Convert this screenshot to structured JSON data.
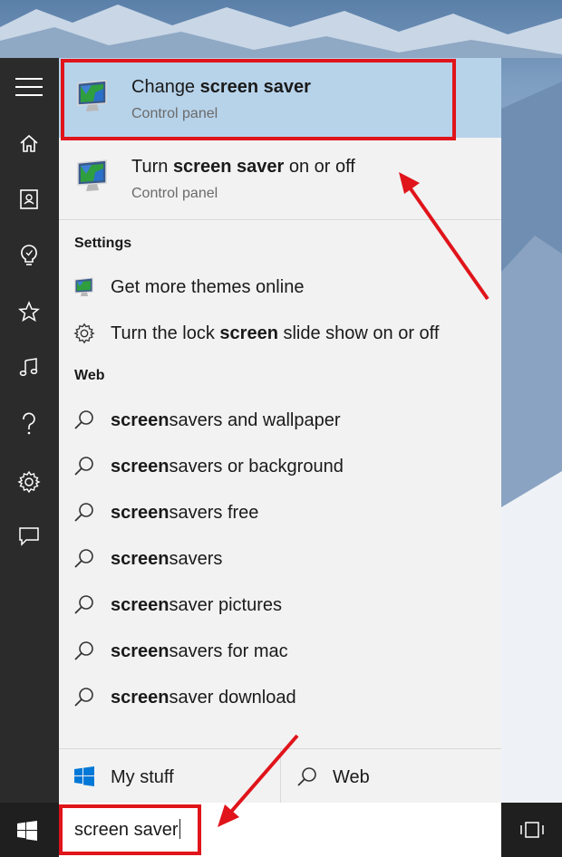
{
  "colors": {
    "accent_selected": "#b7d3ea",
    "annotation_red": "#e0141b",
    "sidebar": "#2b2b2b",
    "panel": "#f2f2f2"
  },
  "sidebar": {
    "items": [
      {
        "name": "hamburger-menu-icon"
      },
      {
        "name": "home-icon"
      },
      {
        "name": "notebook-icon"
      },
      {
        "name": "reminders-icon"
      },
      {
        "name": "favorites-icon"
      },
      {
        "name": "music-icon"
      },
      {
        "name": "help-icon"
      },
      {
        "name": "settings-gear-icon"
      },
      {
        "name": "feedback-icon"
      }
    ]
  },
  "best_match": [
    {
      "title_pre": "Change ",
      "title_bold": "screen saver",
      "title_post": "",
      "subtitle": "Control panel",
      "selected": true
    },
    {
      "title_pre": "Turn ",
      "title_bold": "screen saver",
      "title_post": " on or off",
      "subtitle": "Control panel",
      "selected": false
    }
  ],
  "settings": {
    "heading": "Settings",
    "items": [
      {
        "pre": "Get more themes online",
        "bold": "",
        "post": "",
        "icon": "monitor-icon"
      },
      {
        "pre": "Turn the lock ",
        "bold": "screen",
        "post": " slide show on or off",
        "icon": "gear-icon"
      }
    ]
  },
  "web": {
    "heading": "Web",
    "items": [
      {
        "bold": "screen",
        "post": "savers and wallpaper"
      },
      {
        "bold": "screen",
        "post": "savers or background"
      },
      {
        "bold": "screen",
        "post": "savers free"
      },
      {
        "bold": "screen",
        "post": "savers"
      },
      {
        "bold": "screen",
        "post": "saver pictures"
      },
      {
        "bold": "screen",
        "post": "savers for mac"
      },
      {
        "bold": "screen",
        "post": "saver download"
      }
    ]
  },
  "tabs": {
    "my_stuff": "My stuff",
    "web": "Web"
  },
  "search": {
    "query": "screen saver"
  }
}
